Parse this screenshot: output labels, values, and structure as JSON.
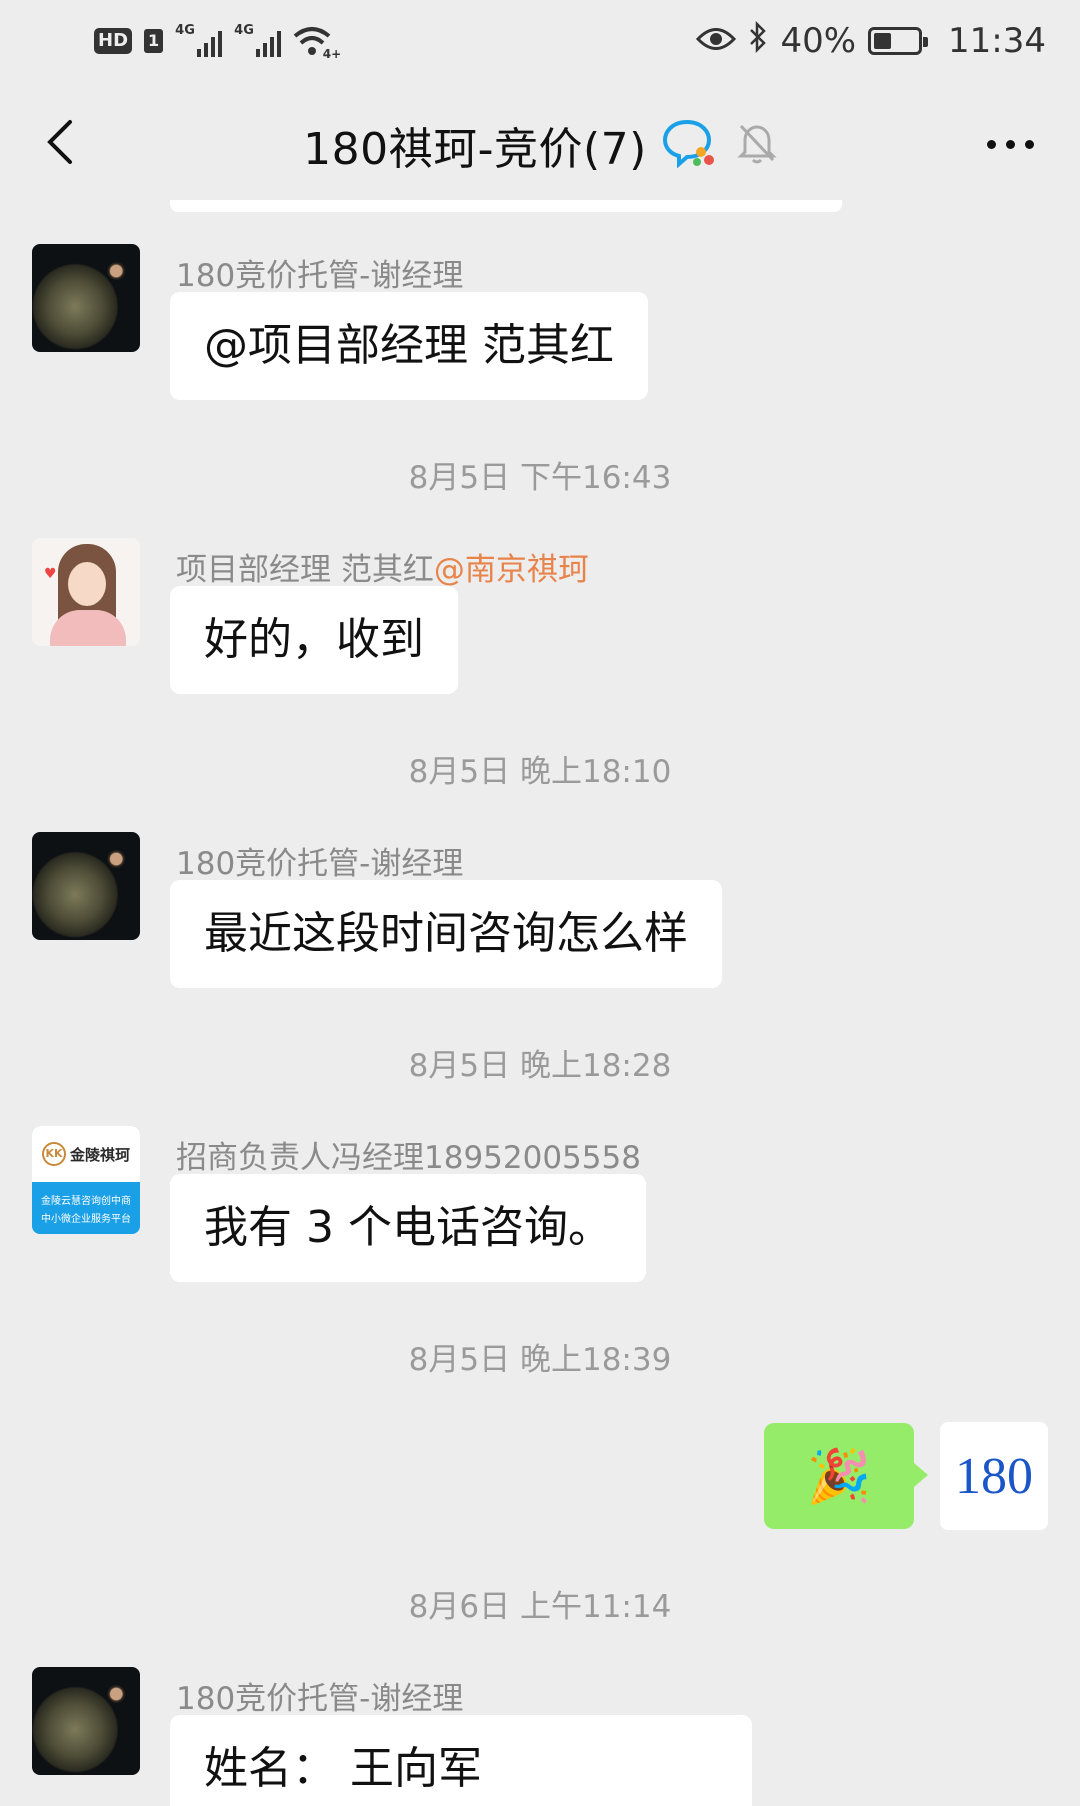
{
  "status_bar": {
    "hd": "HD",
    "sim": "1",
    "net1": "4G",
    "net2": "4G",
    "wifi_tag": "4+",
    "battery": "40%",
    "time": "11:34",
    "battery_level": 0.4
  },
  "header": {
    "title": "180祺珂-竞价(7)"
  },
  "messages": [
    {
      "sender": "180竞价托管-谢经理",
      "text": "@项目部经理 范其红",
      "avatar": "planet-avatar"
    },
    {
      "time": "8月5日 下午16:43"
    },
    {
      "sender": "项目部经理 范其红",
      "sender_org": "@南京祺珂",
      "text": "好的，收到",
      "avatar": "girl-avatar"
    },
    {
      "time": "8月5日 晚上18:10"
    },
    {
      "sender": "180竞价托管-谢经理",
      "text": "最近这段时间咨询怎么样",
      "avatar": "planet-avatar"
    },
    {
      "time": "8月5日 晚上18:28"
    },
    {
      "sender": "招商负责人冯经理18952005558",
      "text": "我有 3 个电话咨询。",
      "avatar": "company-logo-avatar",
      "avatar_text": {
        "logo": "金陵祺珂",
        "mark": "KK",
        "line1": "金陵云慧咨询创中商",
        "line2": "中小微企业服务平台"
      }
    },
    {
      "time": "8月5日 晚上18:39"
    },
    {
      "self_sticker": "🎉",
      "self_avatar_text": "180"
    },
    {
      "time": "8月6日 上午11:14"
    },
    {
      "sender": "180竞价托管-谢经理",
      "text": "姓名：  王向军",
      "avatar": "planet-avatar"
    }
  ]
}
